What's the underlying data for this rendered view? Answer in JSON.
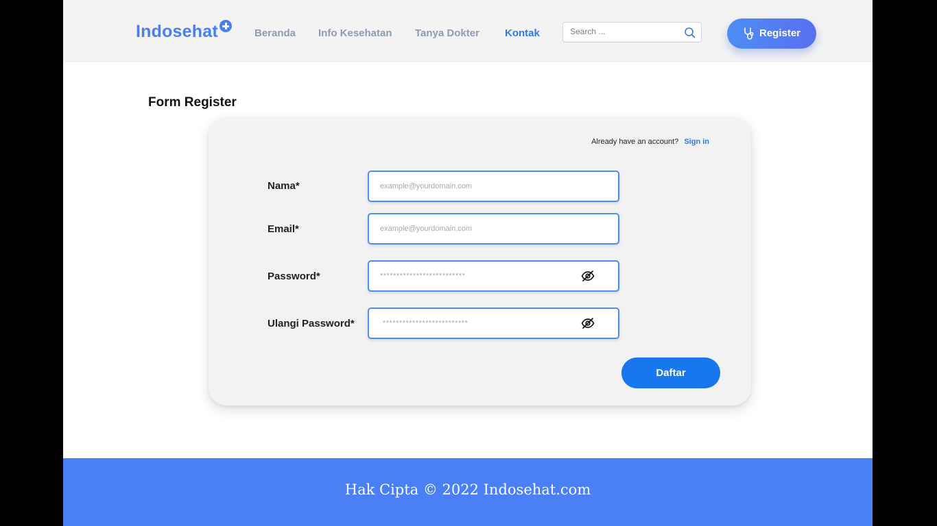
{
  "brand": {
    "name": "Indosehat",
    "accent": "#4a7ff0"
  },
  "nav": {
    "items": [
      {
        "label": "Beranda",
        "active": false
      },
      {
        "label": "Info Kesehatan",
        "active": false
      },
      {
        "label": "Tanya Dokter",
        "active": false
      },
      {
        "label": "Kontak",
        "active": true
      }
    ]
  },
  "search": {
    "placeholder": "Search ...",
    "icon": "search-icon"
  },
  "header_button": {
    "label": "Register",
    "icon": "stethoscope-icon"
  },
  "main": {
    "title": "Form Register"
  },
  "form": {
    "signin_prompt": "Already have an account?",
    "signin_link": "Sign in",
    "fields": [
      {
        "label": "Nama*",
        "placeholder": "example@yourdomain.com"
      },
      {
        "label": "Email*",
        "placeholder": "example@yourdomain.com"
      },
      {
        "label": "Password*",
        "placeholder": "**************************",
        "icon": "eye-off-icon"
      },
      {
        "label": "Ulangi Password*",
        "placeholder": "**************************",
        "icon": "eye-off-icon"
      }
    ],
    "submit_label": "Daftar"
  },
  "footer": {
    "text": "Hak Cipta © 2022 Indosehat.com",
    "color": "#4a7ff5"
  }
}
